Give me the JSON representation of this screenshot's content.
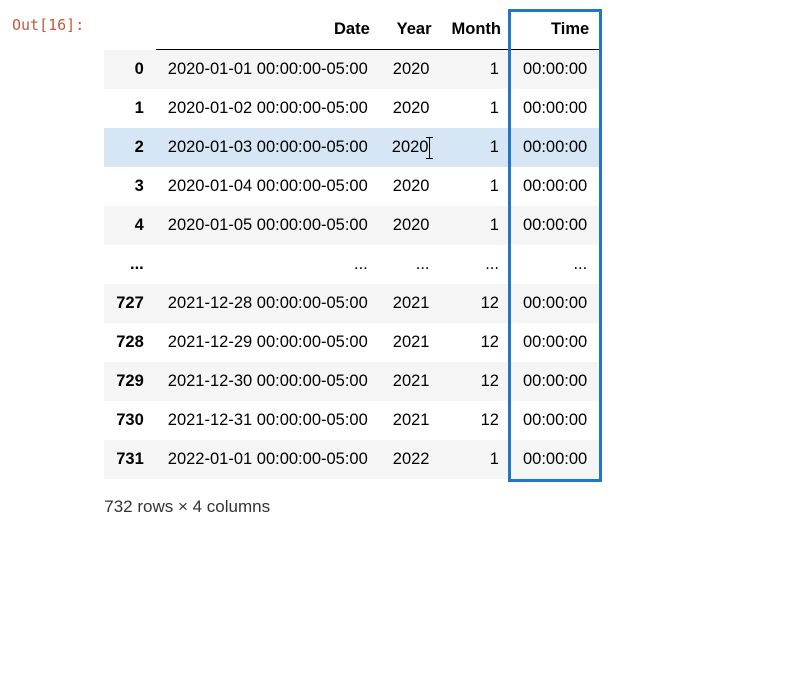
{
  "prompt": "Out[16]:",
  "table": {
    "columns": [
      "Date",
      "Year",
      "Month",
      "Time"
    ],
    "rows": [
      {
        "index": "0",
        "date": "2020-01-01 00:00:00-05:00",
        "year": "2020",
        "month": "1",
        "time": "00:00:00",
        "hover": false
      },
      {
        "index": "1",
        "date": "2020-01-02 00:00:00-05:00",
        "year": "2020",
        "month": "1",
        "time": "00:00:00",
        "hover": false
      },
      {
        "index": "2",
        "date": "2020-01-03 00:00:00-05:00",
        "year": "2020",
        "month": "1",
        "time": "00:00:00",
        "hover": true,
        "cursor_after_year": true
      },
      {
        "index": "3",
        "date": "2020-01-04 00:00:00-05:00",
        "year": "2020",
        "month": "1",
        "time": "00:00:00",
        "hover": false
      },
      {
        "index": "4",
        "date": "2020-01-05 00:00:00-05:00",
        "year": "2020",
        "month": "1",
        "time": "00:00:00",
        "hover": false
      },
      {
        "index": "...",
        "date": "...",
        "year": "...",
        "month": "...",
        "time": "...",
        "hover": false
      },
      {
        "index": "727",
        "date": "2021-12-28 00:00:00-05:00",
        "year": "2021",
        "month": "12",
        "time": "00:00:00",
        "hover": false
      },
      {
        "index": "728",
        "date": "2021-12-29 00:00:00-05:00",
        "year": "2021",
        "month": "12",
        "time": "00:00:00",
        "hover": false
      },
      {
        "index": "729",
        "date": "2021-12-30 00:00:00-05:00",
        "year": "2021",
        "month": "12",
        "time": "00:00:00",
        "hover": false
      },
      {
        "index": "730",
        "date": "2021-12-31 00:00:00-05:00",
        "year": "2021",
        "month": "12",
        "time": "00:00:00",
        "hover": false
      },
      {
        "index": "731",
        "date": "2022-01-01 00:00:00-05:00",
        "year": "2022",
        "month": "1",
        "time": "00:00:00",
        "hover": false
      }
    ]
  },
  "footer": "732 rows × 4 columns",
  "highlight_column": "Time"
}
